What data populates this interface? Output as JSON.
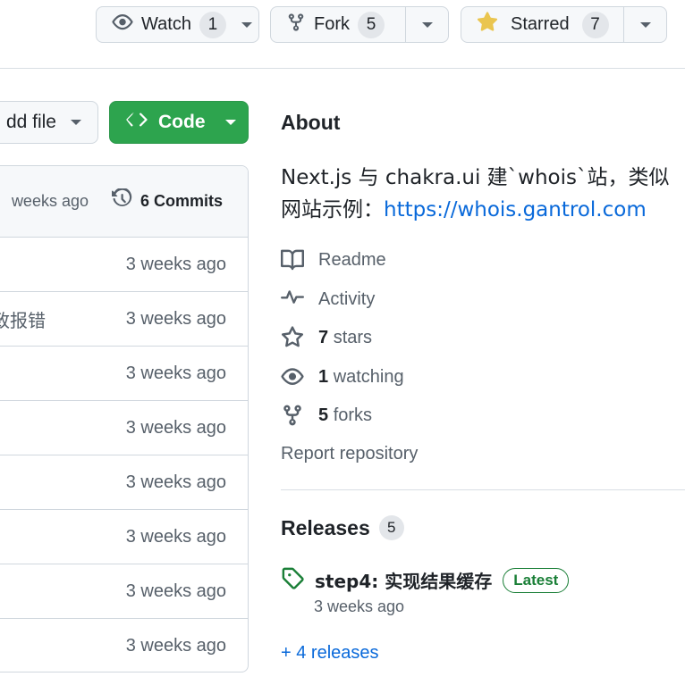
{
  "header": {
    "watch": {
      "label": "Watch",
      "count": "1"
    },
    "fork": {
      "label": "Fork",
      "count": "5"
    },
    "star": {
      "label": "Starred",
      "count": "7"
    }
  },
  "toolbar": {
    "add_file_label": "dd file",
    "code_label": "Code"
  },
  "files": {
    "header_ago": "weeks ago",
    "commits_label": "6 Commits",
    "rows": [
      {
        "message": "",
        "time": "3 weeks ago"
      },
      {
        "message": "致报错",
        "time": "3 weeks ago"
      },
      {
        "message": "",
        "time": "3 weeks ago"
      },
      {
        "message": "",
        "time": "3 weeks ago"
      },
      {
        "message": "",
        "time": "3 weeks ago"
      },
      {
        "message": "",
        "time": "3 weeks ago"
      },
      {
        "message": "",
        "time": "3 weeks ago"
      },
      {
        "message": "",
        "time": "3 weeks ago"
      }
    ]
  },
  "about": {
    "title": "About",
    "description": "Next.js 与 chakra.ui 建`whois`站，类似网站示例：",
    "link": "https://whois.gantrol.com",
    "readme": "Readme",
    "activity": "Activity",
    "stars_count": "7",
    "stars_label": "stars",
    "watching_count": "1",
    "watching_label": "watching",
    "forks_count": "5",
    "forks_label": "forks",
    "report": "Report repository"
  },
  "releases": {
    "title": "Releases",
    "count": "5",
    "latest_name": "step4: 实现结果缓存",
    "latest_badge": "Latest",
    "latest_time": "3 weeks ago",
    "more": "+ 4 releases"
  },
  "colors": {
    "accent": "#0969da",
    "code_button": "#2da44e",
    "star": "#eac54f",
    "latest": "#1a7f37"
  }
}
